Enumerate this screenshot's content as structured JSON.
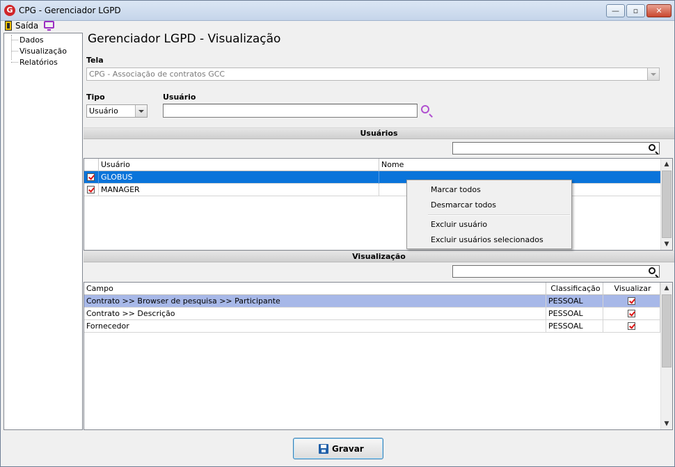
{
  "window": {
    "title": "CPG - Gerenciador LGPD",
    "controls": {
      "minimize": "—",
      "maximize": "▫",
      "close": "✕"
    }
  },
  "toolbar": {
    "exit_label": "Saída",
    "exit_icon": "exit-door-icon",
    "monitor_icon": "monitor-icon"
  },
  "tree": {
    "items": [
      "Dados",
      "Visualização",
      "Relatórios"
    ]
  },
  "main": {
    "title": "Gerenciador LGPD - Visualização",
    "tela_label": "Tela",
    "tela_value": "CPG - Associação de contratos GCC",
    "tipo_label": "Tipo",
    "tipo_value": "Usuário",
    "usuario_label": "Usuário",
    "usuario_value": ""
  },
  "users_section": {
    "header": "Usuários",
    "filter_value": "",
    "columns": [
      "Usuário",
      "Nome"
    ],
    "rows": [
      {
        "user": "GLOBUS",
        "name": "",
        "checked": true,
        "selected": true
      },
      {
        "user": "MANAGER",
        "name": "",
        "checked": true,
        "selected": false
      }
    ]
  },
  "context_menu": {
    "items": [
      "Marcar todos",
      "Desmarcar todos",
      "Excluir usuário",
      "Excluir usuários selecionados"
    ]
  },
  "visual_section": {
    "header": "Visualização",
    "filter_value": "",
    "columns": [
      "Campo",
      "Classificação",
      "Visualizar"
    ],
    "rows": [
      {
        "campo": "Contrato >> Browser de pesquisa >> Participante",
        "class": "PESSOAL",
        "visualizar": true
      },
      {
        "campo": "Contrato >> Descrição",
        "class": "PESSOAL",
        "visualizar": true
      },
      {
        "campo": "Fornecedor",
        "class": "PESSOAL",
        "visualizar": true
      }
    ]
  },
  "footer": {
    "save_label": "Gravar"
  },
  "colors": {
    "selection": "#0a74da",
    "highlight": "#a7b8e8",
    "check": "#dd1111",
    "accent_purple": "#b050d0"
  }
}
